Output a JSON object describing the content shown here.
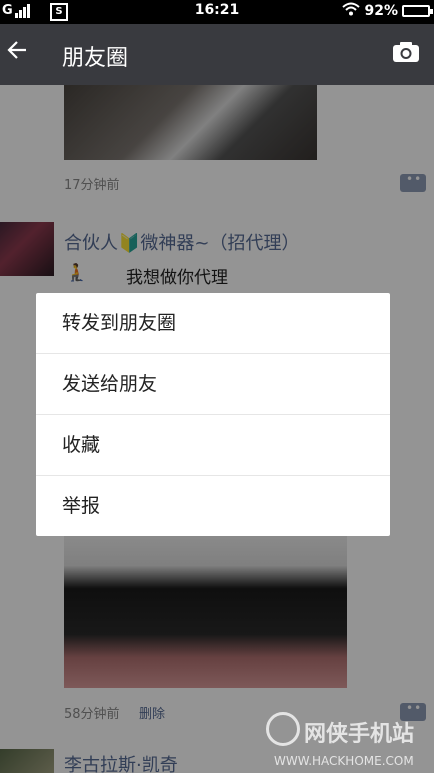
{
  "status_bar": {
    "carrier_left": "G",
    "sim_icon_label": "S",
    "time": "16:21",
    "battery": "92%"
  },
  "nav": {
    "title": "朋友圈"
  },
  "feed": {
    "post1": {
      "time": "17分钟前"
    },
    "post2": {
      "nickname": "合伙人🔰微神器~（招代理）",
      "emoji": "🧎",
      "text": "我想做你代理"
    },
    "post3": {
      "time": "58分钟前",
      "delete_label": "删除"
    },
    "post4": {
      "nickname": "李古拉斯·凯奇"
    }
  },
  "menu": {
    "items": [
      {
        "label": "转发到朋友圈"
      },
      {
        "label": "发送给朋友"
      },
      {
        "label": "收藏"
      },
      {
        "label": "举报"
      }
    ]
  },
  "watermark": {
    "text": "网侠手机站",
    "url": "WWW.HACKHOME.COM"
  }
}
